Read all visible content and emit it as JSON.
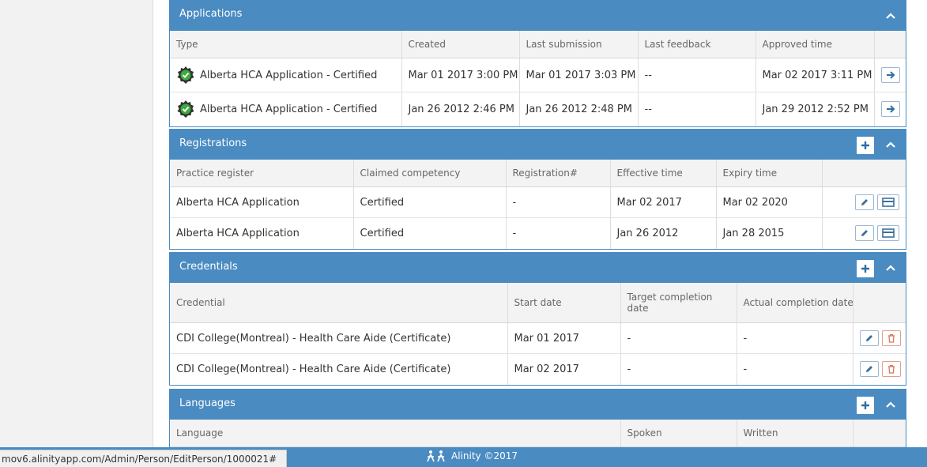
{
  "applications": {
    "title": "Applications",
    "columns": [
      "Type",
      "Created",
      "Last submission",
      "Last feedback",
      "Approved time"
    ],
    "rows": [
      {
        "type": "Alberta HCA Application - Certified",
        "created": "Mar 01 2017 3:00 PM",
        "last_submission": "Mar 01 2017 3:03 PM",
        "last_feedback": "--",
        "approved": "Mar 02 2017 3:11 PM"
      },
      {
        "type": "Alberta HCA Application - Certified",
        "created": "Jan 26 2012 2:46 PM",
        "last_submission": "Jan 26 2012 2:48 PM",
        "last_feedback": "--",
        "approved": "Jan 29 2012 2:52 PM"
      }
    ]
  },
  "registrations": {
    "title": "Registrations",
    "columns": [
      "Practice register",
      "Claimed competency",
      "Registration#",
      "Effective time",
      "Expiry time"
    ],
    "rows": [
      {
        "register": "Alberta HCA Application",
        "competency": "Certified",
        "number": "-",
        "effective": "Mar 02 2017",
        "expiry": "Mar 02 2020"
      },
      {
        "register": "Alberta HCA Application",
        "competency": "Certified",
        "number": "-",
        "effective": "Jan 26 2012",
        "expiry": "Jan 28 2015"
      }
    ]
  },
  "credentials": {
    "title": "Credentials",
    "columns": [
      "Credential",
      "Start date",
      "Target completion date",
      "Actual completion date"
    ],
    "rows": [
      {
        "credential": "CDI College(Montreal) - Health Care Aide (Certificate)",
        "start": "Mar 01 2017",
        "target": "-",
        "actual": "-"
      },
      {
        "credential": "CDI College(Montreal) - Health Care Aide (Certificate)",
        "start": "Mar 02 2017",
        "target": "-",
        "actual": "-"
      }
    ]
  },
  "languages": {
    "title": "Languages",
    "columns": [
      "Language",
      "Spoken",
      "Written"
    ]
  },
  "status_bar": {
    "url": "mov6.alinityapp.com/Admin/Person/EditPerson/1000021#",
    "brand": "Alinity ©2017"
  },
  "colors": {
    "header_blue": "#4a8bc2",
    "seal_green": "#3caa3c",
    "danger": "#e0a08a"
  },
  "icons": [
    "seal-check-icon",
    "arrow-right-icon",
    "plus-icon",
    "chevron-up-icon",
    "pencil-icon",
    "card-icon",
    "trash-icon",
    "alinity-logo-icon"
  ]
}
